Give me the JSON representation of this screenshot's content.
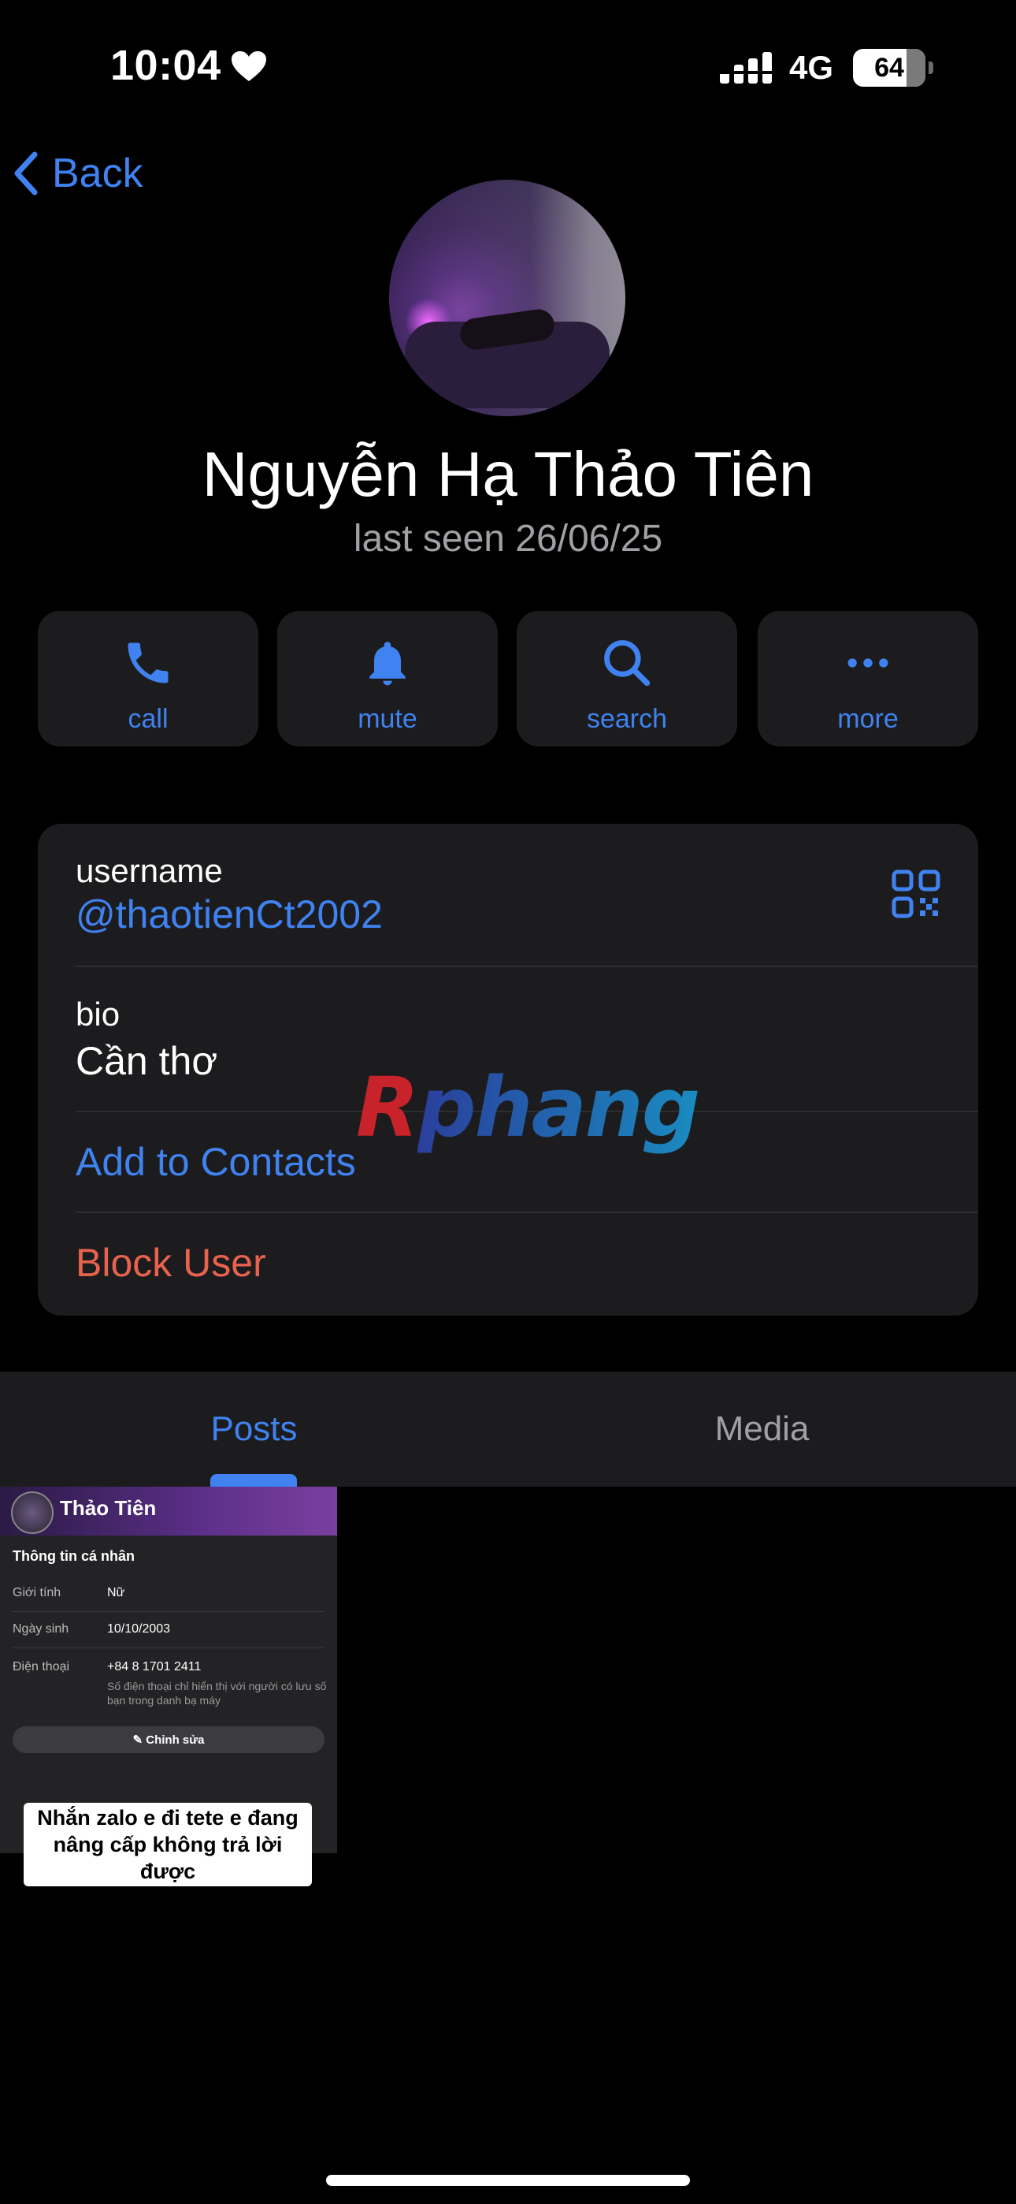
{
  "status_bar": {
    "time": "10:04",
    "network": "4G",
    "battery": "64"
  },
  "nav": {
    "back_label": "Back"
  },
  "profile": {
    "name": "Nguyễn Hạ Thảo Tiên",
    "last_seen": "last seen 26/06/25"
  },
  "actions": [
    {
      "label": "call",
      "icon": "phone-icon"
    },
    {
      "label": "mute",
      "icon": "bell-icon"
    },
    {
      "label": "search",
      "icon": "search-icon"
    },
    {
      "label": "more",
      "icon": "more-icon"
    }
  ],
  "info": {
    "username_label": "username",
    "username": "@thaotienCt2002",
    "bio_label": "bio",
    "bio": "Cần thơ",
    "add_contacts": "Add to Contacts",
    "block_user": "Block User"
  },
  "watermark": {
    "part1": "R",
    "part2": "phang"
  },
  "tabs": {
    "posts": "Posts",
    "media": "Media",
    "active": "Posts"
  },
  "post": {
    "name": "Thảo Tiên",
    "section": "Thông tin cá nhân",
    "rows": [
      {
        "label": "Giới tính",
        "value": "Nữ"
      },
      {
        "label": "Ngày sinh",
        "value": "10/10/2003"
      },
      {
        "label": "Điện thoại",
        "value": "+84 8 1701 2411"
      }
    ],
    "note": "Số điện thoại chỉ hiển thị với người có lưu số bạn trong danh bạ máy",
    "edit_label": "Chỉnh sửa",
    "caption_line1": "Nhắn zalo e đi tete e đang",
    "caption_line2": "nâng cấp không trả lời được"
  },
  "colors": {
    "accent": "#3f82f0",
    "danger": "#e8624d",
    "card": "#1c1c1e",
    "background": "#000000"
  }
}
